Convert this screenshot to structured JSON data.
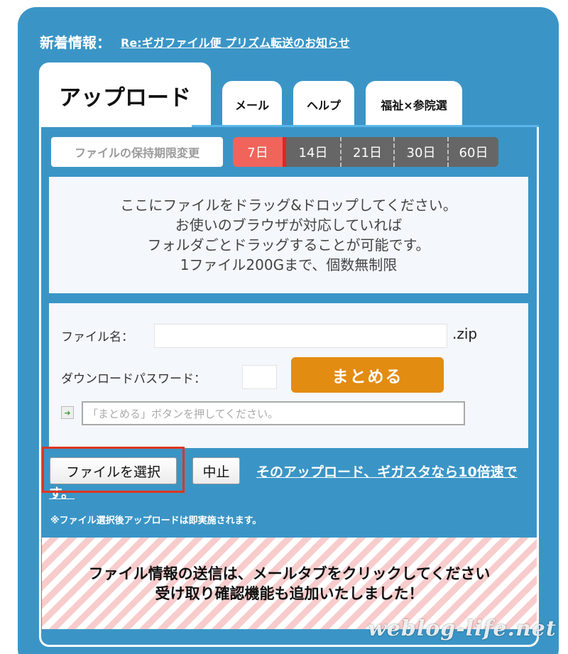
{
  "news": {
    "label": "新着情報：",
    "link": "Re:ギガファイル便 プリズム転送のお知らせ"
  },
  "tabs": [
    {
      "label": "アップロード",
      "active": true
    },
    {
      "label": "メール"
    },
    {
      "label": "ヘルプ"
    },
    {
      "label": "福祉×参院選"
    }
  ],
  "retention": {
    "button_label": "ファイルの保持期限変更",
    "options": [
      "7日",
      "14日",
      "21日",
      "30日",
      "60日"
    ],
    "selected": "7日"
  },
  "drop_zone": {
    "lines": [
      "ここにファイルをドラッグ&ドロップしてください。",
      "お使いのブラウザが対応していれば",
      "フォルダごとドラッグすることが可能です。",
      "1ファイル200Gまで、個数無制限"
    ]
  },
  "form": {
    "filename_label": "ファイル名：",
    "filename_value": "",
    "extension": ".zip",
    "password_label": "ダウンロードパスワード：",
    "password_value": "",
    "combine_button": "まとめる",
    "status_text": "「まとめる」ボタンを押してください。"
  },
  "actions": {
    "choose_file": "ファイルを選択",
    "stop": "中止",
    "promo_link": "そのアップロード、ギガスタなら10倍速です。",
    "note": "※ファイル選択後アップロードは即実施されます。"
  },
  "notice": {
    "line1": "ファイル情報の送信は、メールタブをクリックしてください",
    "line2": "受け取り確認機能も追加いたしました！"
  },
  "watermark": "weblog-life.net",
  "colors": {
    "frame": "#3a95c6",
    "active_period": "#f0645b",
    "combine_button": "#e38c12",
    "highlight": "#e0351d"
  }
}
